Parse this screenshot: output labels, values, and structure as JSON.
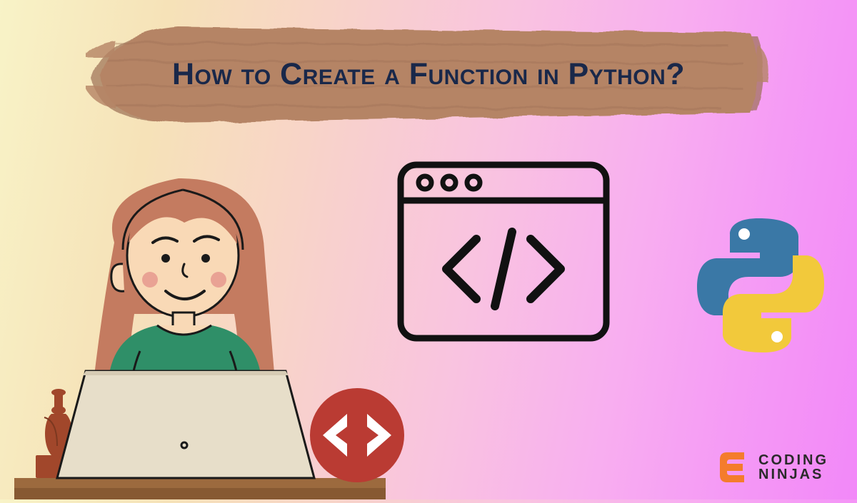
{
  "title": "How to Create a Function in Python?",
  "brand": {
    "line1": "CODING",
    "line2": "NINJAS"
  },
  "colors": {
    "title_text": "#19284a",
    "brush_fill": "#b58465",
    "brush_shadow": "#9c6f55",
    "badge_red": "#ba3b33",
    "badge_white": "#ffffff",
    "python_blue": "#3a78a6",
    "python_yellow": "#f2c93b",
    "brand_orange": "#f47c2c",
    "brand_text": "#2a2a2a",
    "hair": "#c47b60",
    "skin": "#f9d9b6",
    "blush": "#e9a294",
    "shirt": "#2f8f68",
    "laptop": "#e7dec9",
    "laptop_shade": "#d6cbb4",
    "desk_wood": "#9c6a3e",
    "desk_shade": "#875932",
    "vase": "#a1472b"
  }
}
